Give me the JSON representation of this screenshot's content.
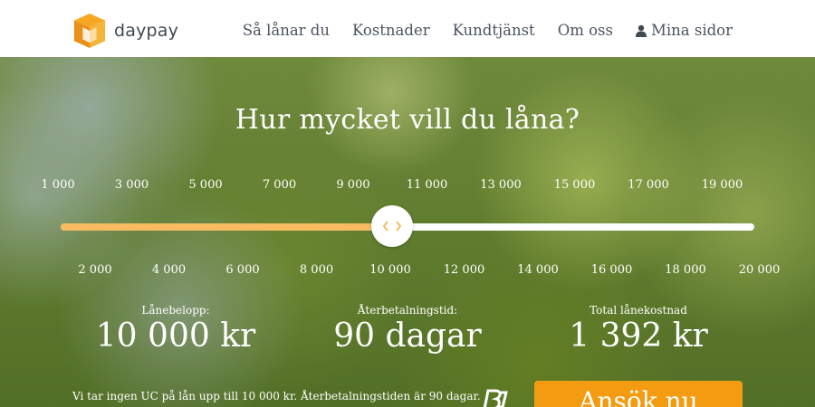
{
  "header": {
    "logo_text": "daypay",
    "logo_icon": "cube-logo-icon",
    "nav": [
      "Så lånar du",
      "Kostnader",
      "Kundtjänst",
      "Om oss"
    ],
    "my_pages": "Mina sidor",
    "my_pages_icon": "user-icon"
  },
  "hero": {
    "title": "Hur mycket vill du låna?",
    "slider": {
      "top_ticks": [
        "1 000",
        "3 000",
        "5 000",
        "7 000",
        "9 000",
        "11 000",
        "13 000",
        "15 000",
        "17 000",
        "19 000"
      ],
      "bottom_ticks": [
        "2 000",
        "4 000",
        "6 000",
        "8 000",
        "10 000",
        "12 000",
        "14 000",
        "16 000",
        "18 000",
        "20 000"
      ],
      "min": 1000,
      "max": 20000,
      "value": 10000,
      "fill_color": "#f7bb61",
      "handle_icon": "chevron-left-right-icon"
    },
    "summary": {
      "amount_label": "Lånebelopp:",
      "amount_value": "10 000 kr",
      "term_label": "Återbetalningstid:",
      "term_value": "90 dagar",
      "cost_label": "Total lånekostnad",
      "cost_value": "1 392 kr"
    },
    "note": "Vi tar ingen UC på lån upp till 10 000 kr. Återbetalningstiden är 90 dagar.",
    "apply_label": "Ansök nu",
    "apply_color": "#f39c12"
  }
}
